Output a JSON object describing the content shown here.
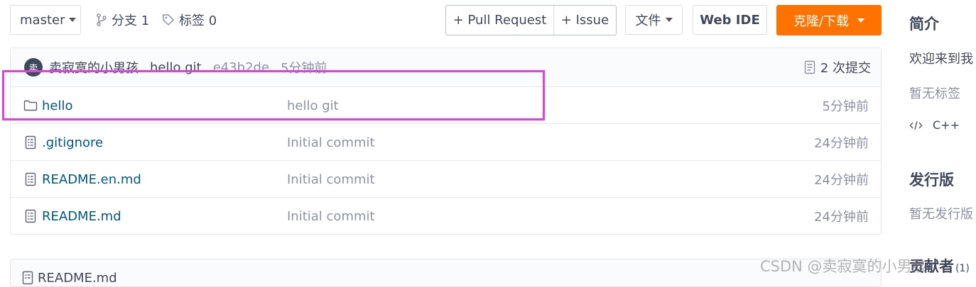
{
  "toolbar": {
    "branch_selector": "master",
    "branches_label": "分支 1",
    "tags_label": "标签 0",
    "pull_request": "+ Pull Request",
    "issue": "+ Issue",
    "file_menu": "文件",
    "web_ide": "Web IDE",
    "clone_download": "克隆/下载"
  },
  "commit_bar": {
    "avatar_letter": "卖",
    "author": "卖寂寞的小男孩",
    "message": "hello git",
    "hash": "e43b2de",
    "time": "5分钟前",
    "commit_count": "2 次提交"
  },
  "files": [
    {
      "name": "hello",
      "type": "folder",
      "message": "hello git",
      "time": "5分钟前"
    },
    {
      "name": ".gitignore",
      "type": "file",
      "message": "Initial commit",
      "time": "24分钟前"
    },
    {
      "name": "README.en.md",
      "type": "file",
      "message": "Initial commit",
      "time": "24分钟前"
    },
    {
      "name": "README.md",
      "type": "file",
      "message": "Initial commit",
      "time": "24分钟前"
    }
  ],
  "readme_panel": {
    "title": "README.md"
  },
  "sidebar": {
    "intro_title": "简介",
    "intro_text": "欢迎来到我",
    "no_tags": "暂无标签",
    "language": "C++",
    "release_title": "发行版",
    "no_release": "暂无发行版",
    "contributors_title": "贡献者",
    "contributors_count": "(1)"
  },
  "watermark": "CSDN @卖寂寞的小男孩",
  "colors": {
    "accent_orange": "#fe7300",
    "link_blue": "#005980",
    "highlight_box": "#e040e0"
  }
}
